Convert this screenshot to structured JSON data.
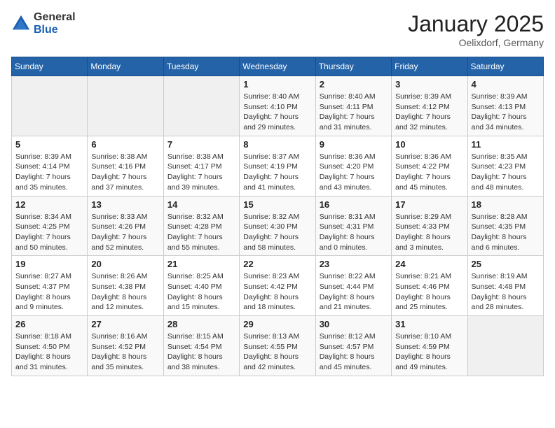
{
  "logo": {
    "general": "General",
    "blue": "Blue"
  },
  "header": {
    "month": "January 2025",
    "location": "Oelixdorf, Germany"
  },
  "weekdays": [
    "Sunday",
    "Monday",
    "Tuesday",
    "Wednesday",
    "Thursday",
    "Friday",
    "Saturday"
  ],
  "weeks": [
    [
      {
        "day": "",
        "detail": ""
      },
      {
        "day": "",
        "detail": ""
      },
      {
        "day": "",
        "detail": ""
      },
      {
        "day": "1",
        "detail": "Sunrise: 8:40 AM\nSunset: 4:10 PM\nDaylight: 7 hours\nand 29 minutes."
      },
      {
        "day": "2",
        "detail": "Sunrise: 8:40 AM\nSunset: 4:11 PM\nDaylight: 7 hours\nand 31 minutes."
      },
      {
        "day": "3",
        "detail": "Sunrise: 8:39 AM\nSunset: 4:12 PM\nDaylight: 7 hours\nand 32 minutes."
      },
      {
        "day": "4",
        "detail": "Sunrise: 8:39 AM\nSunset: 4:13 PM\nDaylight: 7 hours\nand 34 minutes."
      }
    ],
    [
      {
        "day": "5",
        "detail": "Sunrise: 8:39 AM\nSunset: 4:14 PM\nDaylight: 7 hours\nand 35 minutes."
      },
      {
        "day": "6",
        "detail": "Sunrise: 8:38 AM\nSunset: 4:16 PM\nDaylight: 7 hours\nand 37 minutes."
      },
      {
        "day": "7",
        "detail": "Sunrise: 8:38 AM\nSunset: 4:17 PM\nDaylight: 7 hours\nand 39 minutes."
      },
      {
        "day": "8",
        "detail": "Sunrise: 8:37 AM\nSunset: 4:19 PM\nDaylight: 7 hours\nand 41 minutes."
      },
      {
        "day": "9",
        "detail": "Sunrise: 8:36 AM\nSunset: 4:20 PM\nDaylight: 7 hours\nand 43 minutes."
      },
      {
        "day": "10",
        "detail": "Sunrise: 8:36 AM\nSunset: 4:22 PM\nDaylight: 7 hours\nand 45 minutes."
      },
      {
        "day": "11",
        "detail": "Sunrise: 8:35 AM\nSunset: 4:23 PM\nDaylight: 7 hours\nand 48 minutes."
      }
    ],
    [
      {
        "day": "12",
        "detail": "Sunrise: 8:34 AM\nSunset: 4:25 PM\nDaylight: 7 hours\nand 50 minutes."
      },
      {
        "day": "13",
        "detail": "Sunrise: 8:33 AM\nSunset: 4:26 PM\nDaylight: 7 hours\nand 52 minutes."
      },
      {
        "day": "14",
        "detail": "Sunrise: 8:32 AM\nSunset: 4:28 PM\nDaylight: 7 hours\nand 55 minutes."
      },
      {
        "day": "15",
        "detail": "Sunrise: 8:32 AM\nSunset: 4:30 PM\nDaylight: 7 hours\nand 58 minutes."
      },
      {
        "day": "16",
        "detail": "Sunrise: 8:31 AM\nSunset: 4:31 PM\nDaylight: 8 hours\nand 0 minutes."
      },
      {
        "day": "17",
        "detail": "Sunrise: 8:29 AM\nSunset: 4:33 PM\nDaylight: 8 hours\nand 3 minutes."
      },
      {
        "day": "18",
        "detail": "Sunrise: 8:28 AM\nSunset: 4:35 PM\nDaylight: 8 hours\nand 6 minutes."
      }
    ],
    [
      {
        "day": "19",
        "detail": "Sunrise: 8:27 AM\nSunset: 4:37 PM\nDaylight: 8 hours\nand 9 minutes."
      },
      {
        "day": "20",
        "detail": "Sunrise: 8:26 AM\nSunset: 4:38 PM\nDaylight: 8 hours\nand 12 minutes."
      },
      {
        "day": "21",
        "detail": "Sunrise: 8:25 AM\nSunset: 4:40 PM\nDaylight: 8 hours\nand 15 minutes."
      },
      {
        "day": "22",
        "detail": "Sunrise: 8:23 AM\nSunset: 4:42 PM\nDaylight: 8 hours\nand 18 minutes."
      },
      {
        "day": "23",
        "detail": "Sunrise: 8:22 AM\nSunset: 4:44 PM\nDaylight: 8 hours\nand 21 minutes."
      },
      {
        "day": "24",
        "detail": "Sunrise: 8:21 AM\nSunset: 4:46 PM\nDaylight: 8 hours\nand 25 minutes."
      },
      {
        "day": "25",
        "detail": "Sunrise: 8:19 AM\nSunset: 4:48 PM\nDaylight: 8 hours\nand 28 minutes."
      }
    ],
    [
      {
        "day": "26",
        "detail": "Sunrise: 8:18 AM\nSunset: 4:50 PM\nDaylight: 8 hours\nand 31 minutes."
      },
      {
        "day": "27",
        "detail": "Sunrise: 8:16 AM\nSunset: 4:52 PM\nDaylight: 8 hours\nand 35 minutes."
      },
      {
        "day": "28",
        "detail": "Sunrise: 8:15 AM\nSunset: 4:54 PM\nDaylight: 8 hours\nand 38 minutes."
      },
      {
        "day": "29",
        "detail": "Sunrise: 8:13 AM\nSunset: 4:55 PM\nDaylight: 8 hours\nand 42 minutes."
      },
      {
        "day": "30",
        "detail": "Sunrise: 8:12 AM\nSunset: 4:57 PM\nDaylight: 8 hours\nand 45 minutes."
      },
      {
        "day": "31",
        "detail": "Sunrise: 8:10 AM\nSunset: 4:59 PM\nDaylight: 8 hours\nand 49 minutes."
      },
      {
        "day": "",
        "detail": ""
      }
    ]
  ]
}
